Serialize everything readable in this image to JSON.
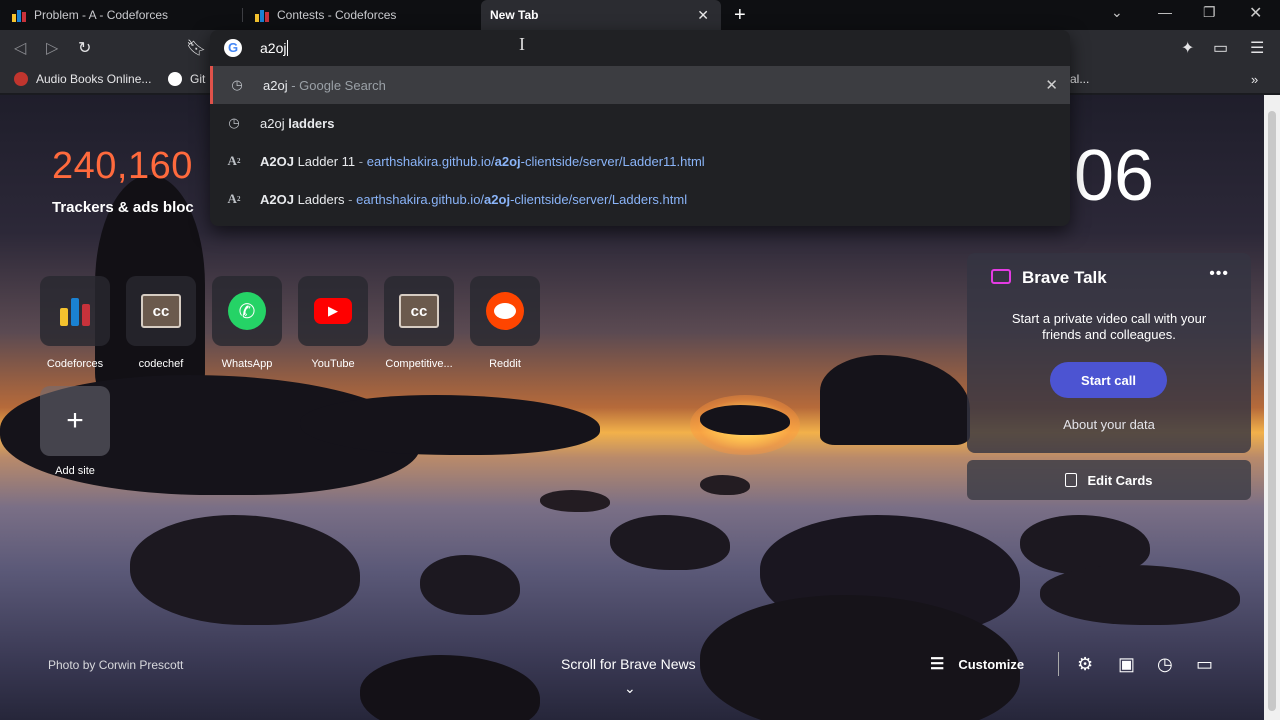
{
  "tabs": [
    {
      "label": "Problem - A - Codeforces",
      "active": false
    },
    {
      "label": "Contests - Codeforces",
      "active": false
    },
    {
      "label": "New Tab",
      "active": true
    }
  ],
  "bookmarks": [
    {
      "label": "Audio Books Online..."
    },
    {
      "label": "Git"
    },
    {
      "label": "al..."
    }
  ],
  "omnibox": {
    "query": "a2oj",
    "suggestions": [
      {
        "icon": "history-icon",
        "main": "a2oj",
        "dim": " - Google Search",
        "selected": true
      },
      {
        "icon": "history-icon",
        "main": "a2oj ",
        "bold": "ladders"
      },
      {
        "icon": "a2oj-favicon",
        "title_bold": "A2OJ",
        "title": " Ladder 11",
        "sep": " - ",
        "url_pre": "earthshakira.github.io/",
        "url_bold": "a2oj",
        "url_post": "-clientside/server/Ladder11.html"
      },
      {
        "icon": "a2oj-favicon",
        "title_bold": "A2OJ",
        "title": " Ladders",
        "sep": " - ",
        "url_pre": "earthshakira.github.io/",
        "url_bold": "a2oj",
        "url_post": "-clientside/server/Ladders.html"
      }
    ]
  },
  "stats": {
    "count": "240,160",
    "label": "Trackers & ads bloc"
  },
  "clock": "06",
  "top_sites": [
    {
      "name": "Codeforces"
    },
    {
      "name": "codechef"
    },
    {
      "name": "WhatsApp"
    },
    {
      "name": "YouTube"
    },
    {
      "name": "Competitive..."
    },
    {
      "name": "Reddit"
    }
  ],
  "add_site": "Add site",
  "brave_talk": {
    "title": "Brave Talk",
    "description": "Start a private video call with your friends and colleagues.",
    "button": "Start call",
    "about": "About your data"
  },
  "edit_cards": "Edit Cards",
  "footer": {
    "credit": "Photo by Corwin Prescott",
    "scroll": "Scroll for Brave News",
    "customize": "Customize"
  },
  "colors": {
    "accent": "#ff6a3d",
    "talk_button": "#4c54d2",
    "url": "#8ab4f8",
    "selected_border": "#e0524a"
  }
}
